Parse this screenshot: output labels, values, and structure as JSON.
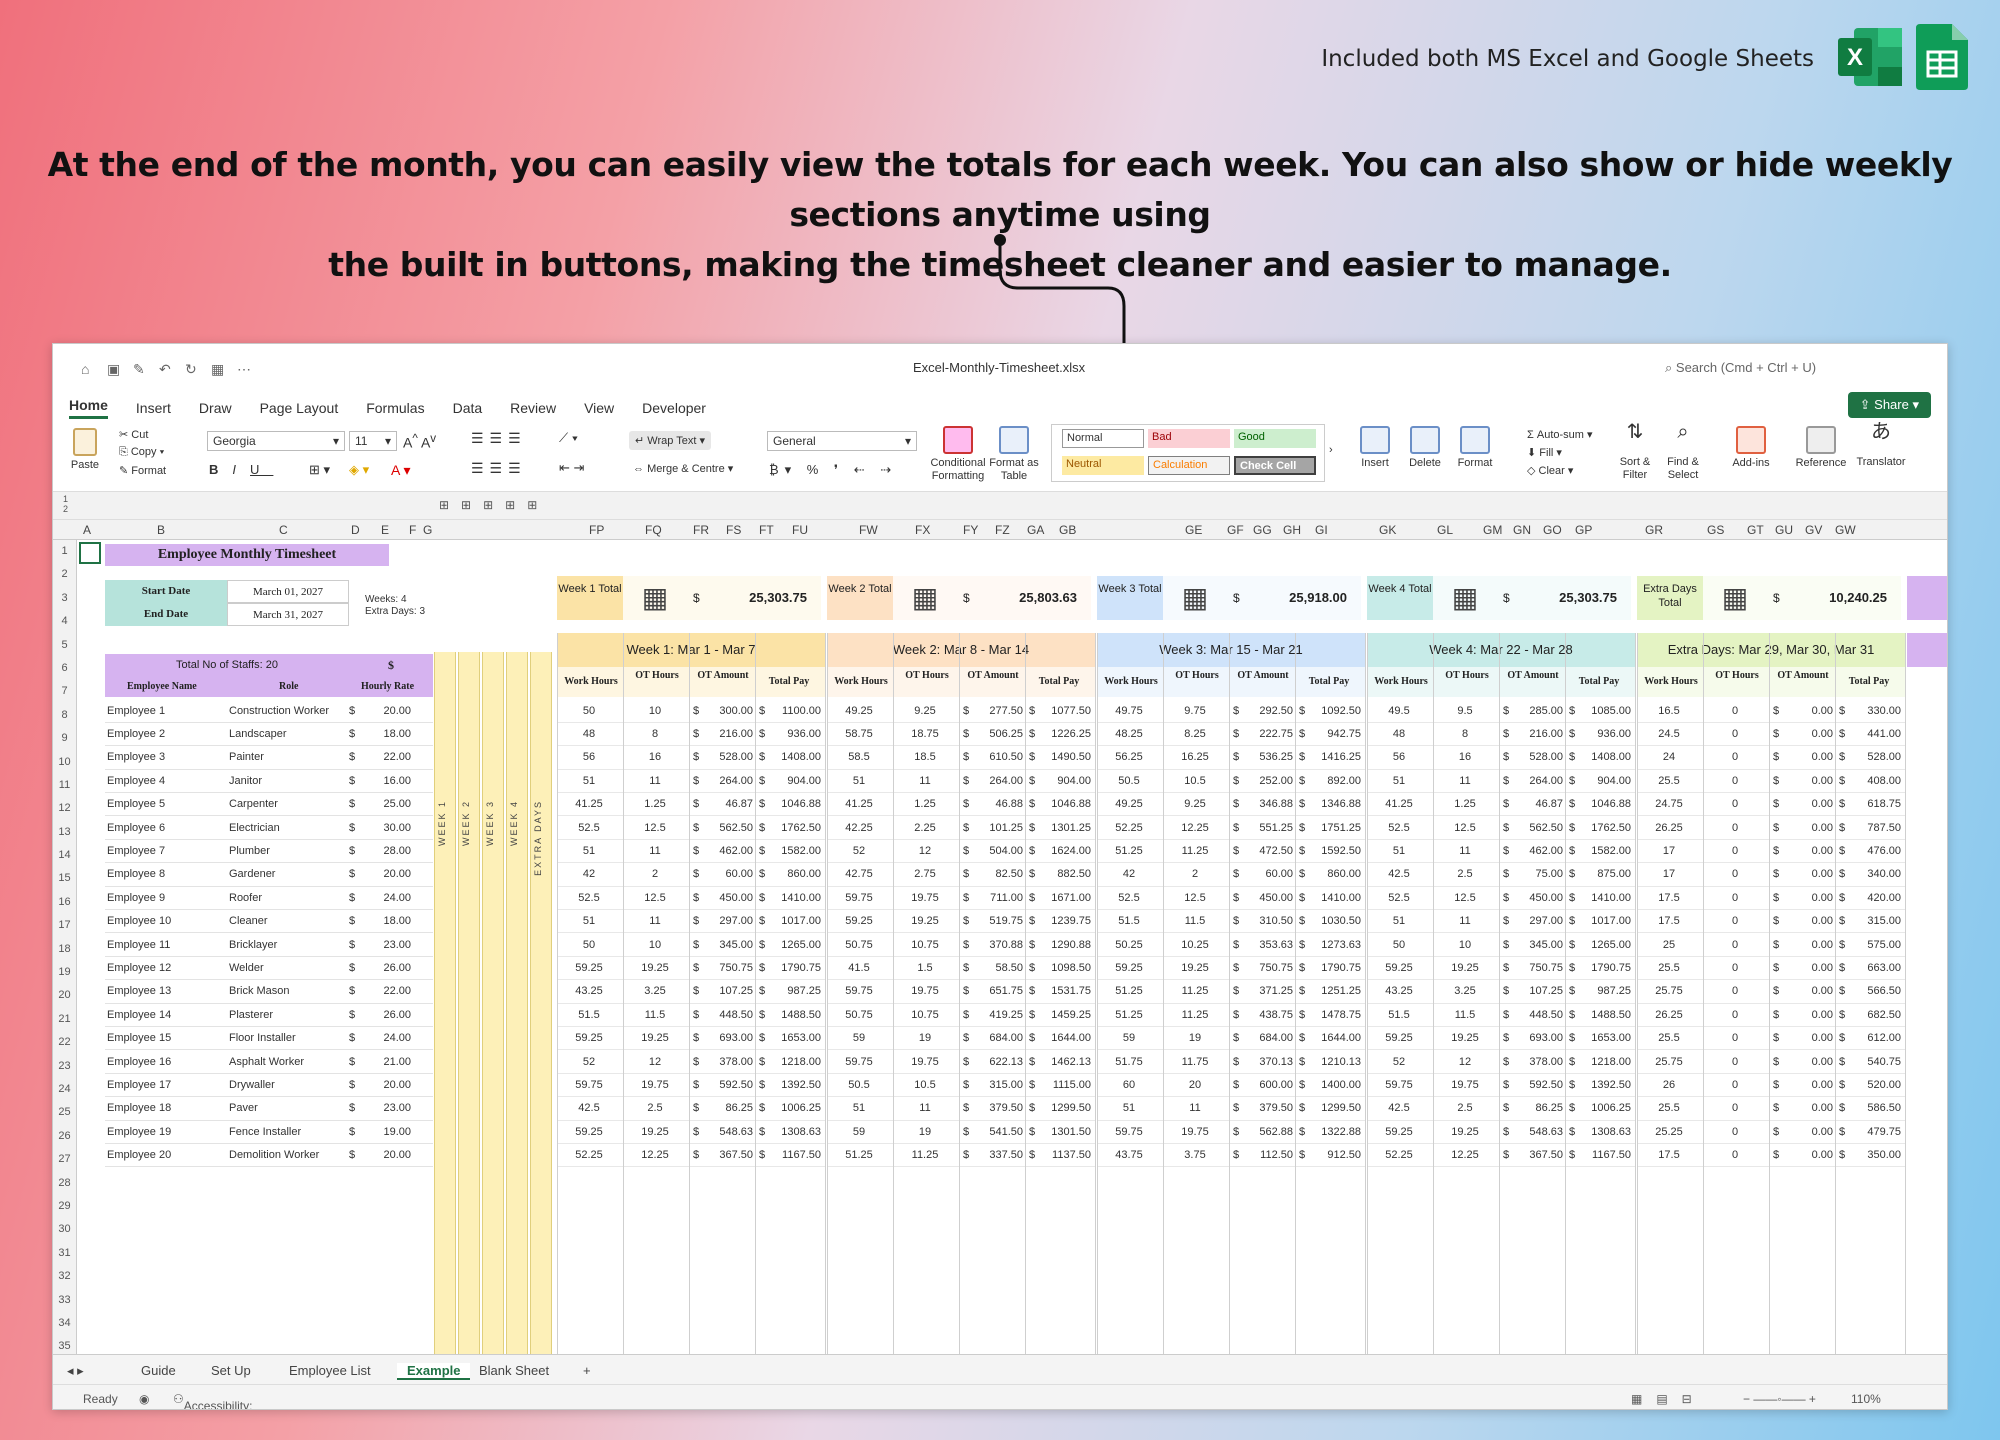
{
  "promo": {
    "top_note": "Included both MS Excel and Google Sheets",
    "headline_line1": "At the end of the month, you can easily view the totals for each week. You can also show or hide weekly sections anytime using",
    "headline_line2": "the built in buttons, making the timesheet cleaner and easier to manage."
  },
  "window": {
    "file_title": "Excel-Monthly-Timesheet.xlsx",
    "search_placeholder": "Search (Cmd + Ctrl + U)",
    "share_label": "Share",
    "menu_tabs": [
      "Home",
      "Insert",
      "Draw",
      "Page Layout",
      "Formulas",
      "Data",
      "Review",
      "View",
      "Developer"
    ],
    "active_tab": "Home"
  },
  "ribbon": {
    "paste": "Paste",
    "cut": "Cut",
    "copy": "Copy",
    "format": "Format",
    "font_name": "Georgia",
    "font_size": "11",
    "wrap_text": "Wrap Text",
    "merge_centre": "Merge & Centre",
    "number_format": "General",
    "cond_format": "Conditional Formatting",
    "format_table": "Format as Table",
    "styles": {
      "normal": "Normal",
      "bad": "Bad",
      "good": "Good",
      "neutral": "Neutral",
      "calculation": "Calculation",
      "check_cell": "Check Cell"
    },
    "insert": "Insert",
    "delete": "Delete",
    "format_cells": "Format",
    "autosum": "Auto-sum",
    "fill": "Fill",
    "clear": "Clear",
    "sort_filter": "Sort & Filter",
    "find_select": "Find & Select",
    "addins": "Add-ins",
    "reference": "Reference",
    "translator": "Translator"
  },
  "column_letters": [
    "A",
    "B",
    "C",
    "D",
    "E",
    "F",
    "G",
    "FP",
    "FQ",
    "FR",
    "FS",
    "FT",
    "FU",
    "FW",
    "FX",
    "FY",
    "FZ",
    "GA",
    "GB",
    "GE",
    "GF",
    "GG",
    "GH",
    "GI",
    "GK",
    "GL",
    "GM",
    "GN",
    "GO",
    "GP",
    "GR",
    "GS",
    "GT",
    "GU",
    "GV",
    "GW"
  ],
  "sheet": {
    "title": "Employee Monthly Timesheet",
    "start_label": "Start Date",
    "start_value": "March 01, 2027",
    "end_label": "End Date",
    "end_value": "March 31, 2027",
    "weeks_note1": "Weeks: 4",
    "weeks_note2": "Extra Days: 3",
    "staff_total": "Total No of Staffs: 20",
    "dollar": "$",
    "col_name": "Employee Name",
    "col_role": "Role",
    "col_rate": "Hourly Rate",
    "week_strips": [
      "WEEK 1",
      "WEEK 2",
      "WEEK 3",
      "WEEK 4",
      "EXTRA DAYS"
    ],
    "sub_headers": [
      "Work Hours",
      "OT Hours",
      "OT Amount",
      "Total Pay"
    ]
  },
  "totals": [
    {
      "label": "Week 1 Total",
      "amount": "25,303.75",
      "color": "#fbe3a6"
    },
    {
      "label": "Week 2 Total",
      "amount": "25,803.63",
      "color": "#fde1c4"
    },
    {
      "label": "Week 3 Total",
      "amount": "25,918.00",
      "color": "#cfe3fa"
    },
    {
      "label": "Week 4 Total",
      "amount": "25,303.75",
      "color": "#c7ebe8"
    },
    {
      "label": "Extra Days Total",
      "amount": "10,240.25",
      "color": "#e4f3c3"
    }
  ],
  "weeks": [
    {
      "title": "Week 1: Mar 1 - Mar 7",
      "color": "#fbe3a6"
    },
    {
      "title": "Week 2: Mar 8 - Mar 14",
      "color": "#fde1c4"
    },
    {
      "title": "Week 3: Mar 15 - Mar 21",
      "color": "#cfe3fa"
    },
    {
      "title": "Week 4: Mar 22 - Mar 28",
      "color": "#c7ebe8"
    },
    {
      "title": "Extra Days: Mar 29, Mar 30, Mar 31",
      "color": "#e4f3c3"
    }
  ],
  "employees": [
    {
      "name": "Employee 1",
      "role": "Construction Worker",
      "rate": "20.00"
    },
    {
      "name": "Employee 2",
      "role": "Landscaper",
      "rate": "18.00"
    },
    {
      "name": "Employee 3",
      "role": "Painter",
      "rate": "22.00"
    },
    {
      "name": "Employee 4",
      "role": "Janitor",
      "rate": "16.00"
    },
    {
      "name": "Employee 5",
      "role": "Carpenter",
      "rate": "25.00"
    },
    {
      "name": "Employee 6",
      "role": "Electrician",
      "rate": "30.00"
    },
    {
      "name": "Employee 7",
      "role": "Plumber",
      "rate": "28.00"
    },
    {
      "name": "Employee 8",
      "role": "Gardener",
      "rate": "20.00"
    },
    {
      "name": "Employee 9",
      "role": "Roofer",
      "rate": "24.00"
    },
    {
      "name": "Employee 10",
      "role": "Cleaner",
      "rate": "18.00"
    },
    {
      "name": "Employee 11",
      "role": "Bricklayer",
      "rate": "23.00"
    },
    {
      "name": "Employee 12",
      "role": "Welder",
      "rate": "26.00"
    },
    {
      "name": "Employee 13",
      "role": "Brick Mason",
      "rate": "22.00"
    },
    {
      "name": "Employee 14",
      "role": "Plasterer",
      "rate": "26.00"
    },
    {
      "name": "Employee 15",
      "role": "Floor Installer",
      "rate": "24.00"
    },
    {
      "name": "Employee 16",
      "role": "Asphalt Worker",
      "rate": "21.00"
    },
    {
      "name": "Employee 17",
      "role": "Drywaller",
      "rate": "20.00"
    },
    {
      "name": "Employee 18",
      "role": "Paver",
      "rate": "23.00"
    },
    {
      "name": "Employee 19",
      "role": "Fence Installer",
      "rate": "19.00"
    },
    {
      "name": "Employee 20",
      "role": "Demolition Worker",
      "rate": "20.00"
    }
  ],
  "week_values": [
    [
      [
        "50",
        "10",
        "300.00",
        "1100.00"
      ],
      [
        "48",
        "8",
        "216.00",
        "936.00"
      ],
      [
        "56",
        "16",
        "528.00",
        "1408.00"
      ],
      [
        "51",
        "11",
        "264.00",
        "904.00"
      ],
      [
        "41.25",
        "1.25",
        "46.87",
        "1046.88"
      ],
      [
        "52.5",
        "12.5",
        "562.50",
        "1762.50"
      ],
      [
        "51",
        "11",
        "462.00",
        "1582.00"
      ],
      [
        "42",
        "2",
        "60.00",
        "860.00"
      ],
      [
        "52.5",
        "12.5",
        "450.00",
        "1410.00"
      ],
      [
        "51",
        "11",
        "297.00",
        "1017.00"
      ],
      [
        "50",
        "10",
        "345.00",
        "1265.00"
      ],
      [
        "59.25",
        "19.25",
        "750.75",
        "1790.75"
      ],
      [
        "43.25",
        "3.25",
        "107.25",
        "987.25"
      ],
      [
        "51.5",
        "11.5",
        "448.50",
        "1488.50"
      ],
      [
        "59.25",
        "19.25",
        "693.00",
        "1653.00"
      ],
      [
        "52",
        "12",
        "378.00",
        "1218.00"
      ],
      [
        "59.75",
        "19.75",
        "592.50",
        "1392.50"
      ],
      [
        "42.5",
        "2.5",
        "86.25",
        "1006.25"
      ],
      [
        "59.25",
        "19.25",
        "548.63",
        "1308.63"
      ],
      [
        "52.25",
        "12.25",
        "367.50",
        "1167.50"
      ]
    ],
    [
      [
        "49.25",
        "9.25",
        "277.50",
        "1077.50"
      ],
      [
        "58.75",
        "18.75",
        "506.25",
        "1226.25"
      ],
      [
        "58.5",
        "18.5",
        "610.50",
        "1490.50"
      ],
      [
        "51",
        "11",
        "264.00",
        "904.00"
      ],
      [
        "41.25",
        "1.25",
        "46.88",
        "1046.88"
      ],
      [
        "42.25",
        "2.25",
        "101.25",
        "1301.25"
      ],
      [
        "52",
        "12",
        "504.00",
        "1624.00"
      ],
      [
        "42.75",
        "2.75",
        "82.50",
        "882.50"
      ],
      [
        "59.75",
        "19.75",
        "711.00",
        "1671.00"
      ],
      [
        "59.25",
        "19.25",
        "519.75",
        "1239.75"
      ],
      [
        "50.75",
        "10.75",
        "370.88",
        "1290.88"
      ],
      [
        "41.5",
        "1.5",
        "58.50",
        "1098.50"
      ],
      [
        "59.75",
        "19.75",
        "651.75",
        "1531.75"
      ],
      [
        "50.75",
        "10.75",
        "419.25",
        "1459.25"
      ],
      [
        "59",
        "19",
        "684.00",
        "1644.00"
      ],
      [
        "59.75",
        "19.75",
        "622.13",
        "1462.13"
      ],
      [
        "50.5",
        "10.5",
        "315.00",
        "1115.00"
      ],
      [
        "51",
        "11",
        "379.50",
        "1299.50"
      ],
      [
        "59",
        "19",
        "541.50",
        "1301.50"
      ],
      [
        "51.25",
        "11.25",
        "337.50",
        "1137.50"
      ]
    ],
    [
      [
        "49.75",
        "9.75",
        "292.50",
        "1092.50"
      ],
      [
        "48.25",
        "8.25",
        "222.75",
        "942.75"
      ],
      [
        "56.25",
        "16.25",
        "536.25",
        "1416.25"
      ],
      [
        "50.5",
        "10.5",
        "252.00",
        "892.00"
      ],
      [
        "49.25",
        "9.25",
        "346.88",
        "1346.88"
      ],
      [
        "52.25",
        "12.25",
        "551.25",
        "1751.25"
      ],
      [
        "51.25",
        "11.25",
        "472.50",
        "1592.50"
      ],
      [
        "42",
        "2",
        "60.00",
        "860.00"
      ],
      [
        "52.5",
        "12.5",
        "450.00",
        "1410.00"
      ],
      [
        "51.5",
        "11.5",
        "310.50",
        "1030.50"
      ],
      [
        "50.25",
        "10.25",
        "353.63",
        "1273.63"
      ],
      [
        "59.25",
        "19.25",
        "750.75",
        "1790.75"
      ],
      [
        "51.25",
        "11.25",
        "371.25",
        "1251.25"
      ],
      [
        "51.25",
        "11.25",
        "438.75",
        "1478.75"
      ],
      [
        "59",
        "19",
        "684.00",
        "1644.00"
      ],
      [
        "51.75",
        "11.75",
        "370.13",
        "1210.13"
      ],
      [
        "60",
        "20",
        "600.00",
        "1400.00"
      ],
      [
        "51",
        "11",
        "379.50",
        "1299.50"
      ],
      [
        "59.75",
        "19.75",
        "562.88",
        "1322.88"
      ],
      [
        "43.75",
        "3.75",
        "112.50",
        "912.50"
      ]
    ],
    [
      [
        "49.5",
        "9.5",
        "285.00",
        "1085.00"
      ],
      [
        "48",
        "8",
        "216.00",
        "936.00"
      ],
      [
        "56",
        "16",
        "528.00",
        "1408.00"
      ],
      [
        "51",
        "11",
        "264.00",
        "904.00"
      ],
      [
        "41.25",
        "1.25",
        "46.87",
        "1046.88"
      ],
      [
        "52.5",
        "12.5",
        "562.50",
        "1762.50"
      ],
      [
        "51",
        "11",
        "462.00",
        "1582.00"
      ],
      [
        "42.5",
        "2.5",
        "75.00",
        "875.00"
      ],
      [
        "52.5",
        "12.5",
        "450.00",
        "1410.00"
      ],
      [
        "51",
        "11",
        "297.00",
        "1017.00"
      ],
      [
        "50",
        "10",
        "345.00",
        "1265.00"
      ],
      [
        "59.25",
        "19.25",
        "750.75",
        "1790.75"
      ],
      [
        "43.25",
        "3.25",
        "107.25",
        "987.25"
      ],
      [
        "51.5",
        "11.5",
        "448.50",
        "1488.50"
      ],
      [
        "59.25",
        "19.25",
        "693.00",
        "1653.00"
      ],
      [
        "52",
        "12",
        "378.00",
        "1218.00"
      ],
      [
        "59.75",
        "19.75",
        "592.50",
        "1392.50"
      ],
      [
        "42.5",
        "2.5",
        "86.25",
        "1006.25"
      ],
      [
        "59.25",
        "19.25",
        "548.63",
        "1308.63"
      ],
      [
        "52.25",
        "12.25",
        "367.50",
        "1167.50"
      ]
    ],
    [
      [
        "16.5",
        "0",
        "0.00",
        "330.00"
      ],
      [
        "24.5",
        "0",
        "0.00",
        "441.00"
      ],
      [
        "24",
        "0",
        "0.00",
        "528.00"
      ],
      [
        "25.5",
        "0",
        "0.00",
        "408.00"
      ],
      [
        "24.75",
        "0",
        "0.00",
        "618.75"
      ],
      [
        "26.25",
        "0",
        "0.00",
        "787.50"
      ],
      [
        "17",
        "0",
        "0.00",
        "476.00"
      ],
      [
        "17",
        "0",
        "0.00",
        "340.00"
      ],
      [
        "17.5",
        "0",
        "0.00",
        "420.00"
      ],
      [
        "17.5",
        "0",
        "0.00",
        "315.00"
      ],
      [
        "25",
        "0",
        "0.00",
        "575.00"
      ],
      [
        "25.5",
        "0",
        "0.00",
        "663.00"
      ],
      [
        "25.75",
        "0",
        "0.00",
        "566.50"
      ],
      [
        "26.25",
        "0",
        "0.00",
        "682.50"
      ],
      [
        "25.5",
        "0",
        "0.00",
        "612.00"
      ],
      [
        "25.75",
        "0",
        "0.00",
        "540.75"
      ],
      [
        "26",
        "0",
        "0.00",
        "520.00"
      ],
      [
        "25.5",
        "0",
        "0.00",
        "586.50"
      ],
      [
        "25.25",
        "0",
        "0.00",
        "479.75"
      ],
      [
        "17.5",
        "0",
        "0.00",
        "350.00"
      ]
    ]
  ],
  "sheet_tabs": [
    "Guide",
    "Set Up",
    "Employee List",
    "Example",
    "Blank Sheet",
    "+"
  ],
  "active_sheet": "Example",
  "status": {
    "ready": "Ready",
    "accessibility": "Accessibility: Investigate",
    "zoom": "110%"
  },
  "colors": {
    "excel_green": "#1f7244",
    "purple": "#d6b3f0",
    "teal": "#b6e3db"
  }
}
